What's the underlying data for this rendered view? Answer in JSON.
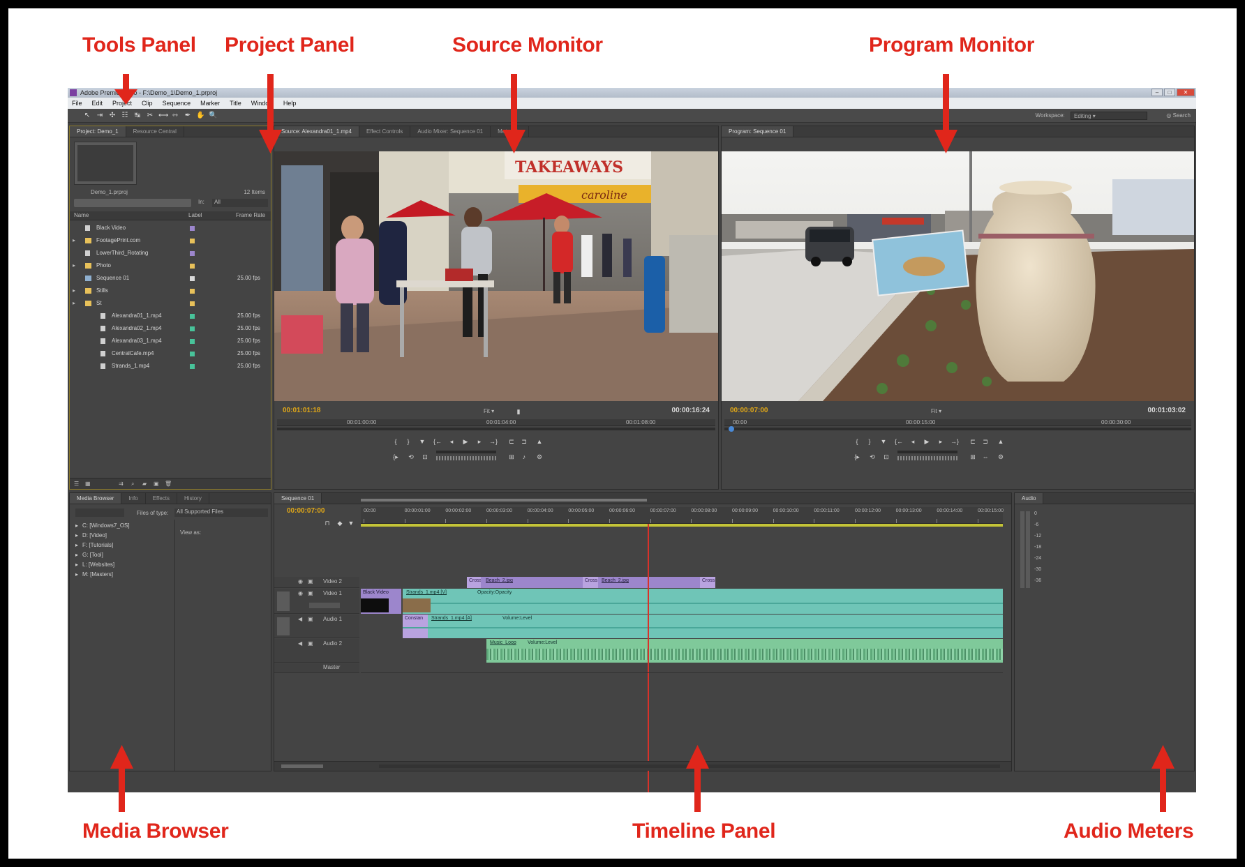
{
  "callouts": {
    "tools_panel": "Tools Panel",
    "project_panel": "Project Panel",
    "source_monitor": "Source Monitor",
    "program_monitor": "Program Monitor",
    "media_browser": "Media Browser",
    "timeline_panel": "Timeline Panel",
    "audio_meters": "Audio Meters"
  },
  "colors": {
    "callout_red": "#e0261b",
    "timecode_yellow": "#e2a817",
    "panel_bg": "#424242",
    "video_clip": "#9c86cc",
    "audio_clip": "#6fc5b7",
    "playhead": "#d8322a"
  },
  "app": {
    "title": "Adobe Premiere Pro - F:\\Demo_1\\Demo_1.prproj",
    "menu": [
      "File",
      "Edit",
      "Project",
      "Clip",
      "Sequence",
      "Marker",
      "Title",
      "Window",
      "Help"
    ],
    "workspace_label": "Workspace:",
    "workspace_value": "Editing",
    "search_label": "Search"
  },
  "project": {
    "tabs": [
      "Project: Demo_1",
      "Resource Central"
    ],
    "project_name": "Demo_1.prproj",
    "item_count": "12 Items",
    "in_label": "In:",
    "in_value": "All",
    "columns": [
      "Name",
      "Label",
      "Frame Rate"
    ],
    "items": [
      {
        "name": "Black Video",
        "icon": "file-icon",
        "label": "#9c86cc",
        "rate": "",
        "indent": 0
      },
      {
        "name": "FootagePrint.com",
        "icon": "folder-icon",
        "label": "#e8c15a",
        "rate": "",
        "indent": 0
      },
      {
        "name": "LowerThird_Rotating",
        "icon": "file-icon",
        "label": "#9c86cc",
        "rate": "",
        "indent": 0
      },
      {
        "name": "Photo",
        "icon": "folder-icon",
        "label": "#e8c15a",
        "rate": "",
        "indent": 0
      },
      {
        "name": "Sequence 01",
        "icon": "sequence-icon",
        "label": "#d9d9d9",
        "rate": "25.00 fps",
        "indent": 0
      },
      {
        "name": "Stills",
        "icon": "folder-icon",
        "label": "#e8c15a",
        "rate": "",
        "indent": 0
      },
      {
        "name": "St",
        "icon": "folder-icon",
        "label": "#e8c15a",
        "rate": "",
        "indent": 0
      },
      {
        "name": "Alexandra01_1.mp4",
        "icon": "file-icon",
        "label": "#48c39a",
        "rate": "25.00 fps",
        "indent": 1
      },
      {
        "name": "Alexandra02_1.mp4",
        "icon": "file-icon",
        "label": "#48c39a",
        "rate": "25.00 fps",
        "indent": 1
      },
      {
        "name": "Alexandra03_1.mp4",
        "icon": "file-icon",
        "label": "#48c39a",
        "rate": "25.00 fps",
        "indent": 1
      },
      {
        "name": "CentralCafe.mp4",
        "icon": "file-icon",
        "label": "#48c39a",
        "rate": "25.00 fps",
        "indent": 1
      },
      {
        "name": "Strands_1.mp4",
        "icon": "file-icon",
        "label": "#48c39a",
        "rate": "25.00 fps",
        "indent": 1
      }
    ]
  },
  "source": {
    "tabs": [
      "Source: Alexandra01_1.mp4",
      "Effect Controls",
      "Audio Mixer: Sequence 01",
      "Metadata"
    ],
    "current_tc": "00:01:01:18",
    "duration_tc": "00:00:16:24",
    "fit": "Fit",
    "ruler_ticks": [
      "00:01:00:00",
      "00:01:04:00",
      "00:01:08:00"
    ],
    "sign": "TAKEAWAYS",
    "sign2": "caroline"
  },
  "program": {
    "tabs": [
      "Program: Sequence 01"
    ],
    "current_tc": "00:00:07:00",
    "duration_tc": "00:01:03:02",
    "fit": "Fit",
    "ruler_ticks": [
      "00:00",
      "00:00:15:00",
      "00:00:30:00"
    ]
  },
  "media_browser": {
    "tabs": [
      "Media Browser",
      "Info",
      "Effects",
      "History"
    ],
    "files_of_type_label": "Files of type:",
    "files_of_type_value": "All Supported Files",
    "view_as_label": "View as:",
    "drives": [
      "C: [Windows7_OS]",
      "D: [Video]",
      "F: [Tutorials]",
      "G: [Tool]",
      "L: [Websites]",
      "M: [Masters]"
    ]
  },
  "timeline": {
    "tabs": [
      "Sequence 01"
    ],
    "timecode": "00:00:07:00",
    "ruler_ticks": [
      "00:00",
      "00:00:01:00",
      "00:00:02:00",
      "00:00:03:00",
      "00:00:04:00",
      "00:00:05:00",
      "00:00:06:00",
      "00:00:07:00",
      "00:00:08:00",
      "00:00:09:00",
      "00:00:10:00",
      "00:00:11:00",
      "00:00:12:00",
      "00:00:13:00",
      "00:00:14:00",
      "00:00:15:00"
    ],
    "playhead_fraction": 0.447,
    "tracks": {
      "video2": "Video 2",
      "video1": "Video 1",
      "audio1": "Audio 1",
      "audio2": "Audio 2",
      "master": "Master"
    },
    "clips": {
      "v2_a": "Beach_2.jpg",
      "v2_a_fx": "Cross",
      "v2_b": "Beach_2.jpg",
      "v2_b_fx": "Cross",
      "v2_c": "Cross",
      "v1_black": "Black Video",
      "v1_main": "Strands_1.mp4 [V]",
      "v1_fx": "Opacity:Opacity",
      "a1_fx": "Constan",
      "a1_main": "Strands_1.mp4 [A]",
      "a1_vol": "Volume:Level",
      "a2_main": "Music_Loop",
      "a2_vol": "Volume:Level"
    }
  },
  "audio_meters": {
    "tabs": [
      "Audio"
    ],
    "scale": [
      "0",
      "-6",
      "-12",
      "-18",
      "-24",
      "-30",
      "-36"
    ]
  }
}
